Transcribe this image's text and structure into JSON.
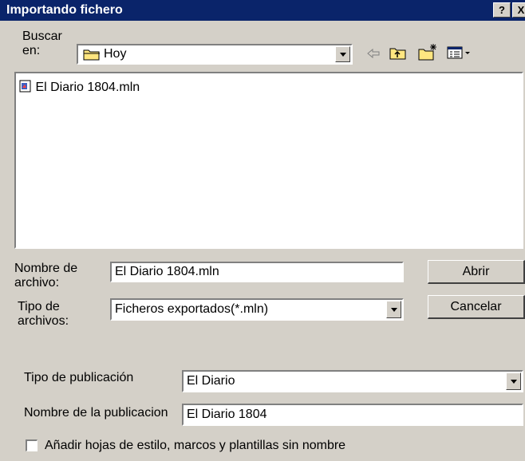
{
  "window": {
    "title": "Importando fichero",
    "help_label": "?",
    "close_label": "X"
  },
  "lookin": {
    "label_line1": "Buscar",
    "label_line2": "en:",
    "value": "Hoy",
    "icon": "folder-icon"
  },
  "toolbar": {
    "back_icon": "back-arrow-icon",
    "up_icon": "up-folder-icon",
    "new_folder_icon": "new-folder-icon",
    "view_icon": "view-menu-icon"
  },
  "files": [
    {
      "name": "El Diario 1804.mln",
      "icon": "file-icon"
    }
  ],
  "filename": {
    "label_line1": "Nombre de",
    "label_line2": "archivo:",
    "value": "El Diario 1804.mln"
  },
  "filetype": {
    "label_line1": "Tipo de",
    "label_line2": "archivos:",
    "value": "Ficheros exportados(*.mln)"
  },
  "buttons": {
    "open": "Abrir",
    "cancel": "Cancelar"
  },
  "pubtype": {
    "label": "Tipo de publicación",
    "value": "El Diario"
  },
  "pubname": {
    "label": "Nombre de la publicacion",
    "value": "El Diario 1804"
  },
  "checkbox": {
    "label": "Añadir hojas de estilo, marcos y plantillas sin nombre",
    "checked": false
  },
  "colors": {
    "titlebar": "#0a246a",
    "face": "#d4d0c8",
    "field": "#ffffff"
  }
}
